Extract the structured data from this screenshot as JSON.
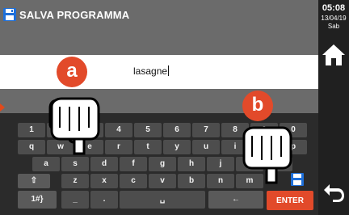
{
  "header": {
    "title": "SALVA PROGRAMMA",
    "time": "05:08",
    "date": "13/04/19",
    "day": "Sab"
  },
  "input": {
    "value": "lasagne"
  },
  "keyboard": {
    "row1": [
      "1",
      "2",
      "3",
      "4",
      "5",
      "6",
      "7",
      "8",
      "9",
      "0"
    ],
    "row2": [
      "q",
      "w",
      "e",
      "r",
      "t",
      "y",
      "u",
      "i",
      "o",
      "p"
    ],
    "row3": [
      "a",
      "s",
      "d",
      "f",
      "g",
      "h",
      "j",
      "k",
      "l"
    ],
    "row4": [
      "⇧",
      "z",
      "x",
      "c",
      "v",
      "b",
      "n",
      "m"
    ],
    "row5": [
      "1#}",
      "_",
      ".",
      "␣",
      "←",
      "ENTER"
    ]
  },
  "callouts": {
    "a": "a",
    "b": "b"
  },
  "icons": [
    "save-icon",
    "home-icon",
    "back-icon",
    "hand-pointer-icon",
    "backspace-icon",
    "shift-icon",
    "space-icon"
  ],
  "colors": {
    "accent": "#e24a2a",
    "keyboard_bg": "#2b2b2b",
    "key": "#4d4d4d"
  }
}
